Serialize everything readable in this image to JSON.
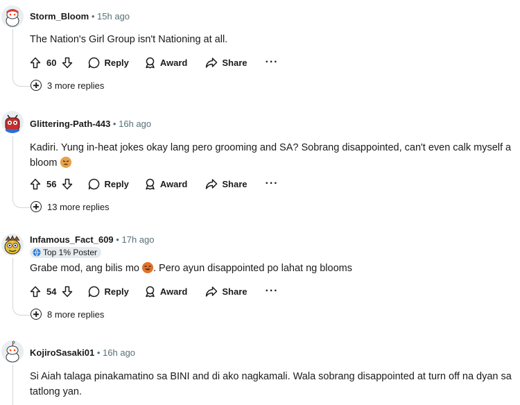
{
  "comments": [
    {
      "username": "Storm_Bloom",
      "time": "15h ago",
      "flair": "",
      "body": "The Nation's Girl Group isn't Nationing at all.",
      "score": "60",
      "more_replies": "3 more replies"
    },
    {
      "username": "Glittering-Path-443",
      "time": "16h ago",
      "flair": "",
      "body": "Kadiri. Yung in-heat jokes okay lang pero grooming and SA? Sobrang disappointed, can't even calk myself a bloom",
      "score": "56",
      "more_replies": "13 more replies"
    },
    {
      "username": "Infamous_Fact_609",
      "time": "17h ago",
      "flair": "Top 1% Poster",
      "body_before": "Grabe mod, ang bilis mo",
      "body_after": ". Pero ayun disappointed po lahat ng blooms",
      "score": "54",
      "more_replies": "8 more replies"
    },
    {
      "username": "KojiroSasaki01",
      "time": "16h ago",
      "flair": "",
      "body": "Si Aiah talaga pinakamatino sa BINI and di ako nagkamali. Wala sobrang disappointed at turn off na dyan sa tatlong yan."
    }
  ],
  "actions": {
    "reply": "Reply",
    "award": "Award",
    "share": "Share",
    "more": "···"
  },
  "separator": "•"
}
